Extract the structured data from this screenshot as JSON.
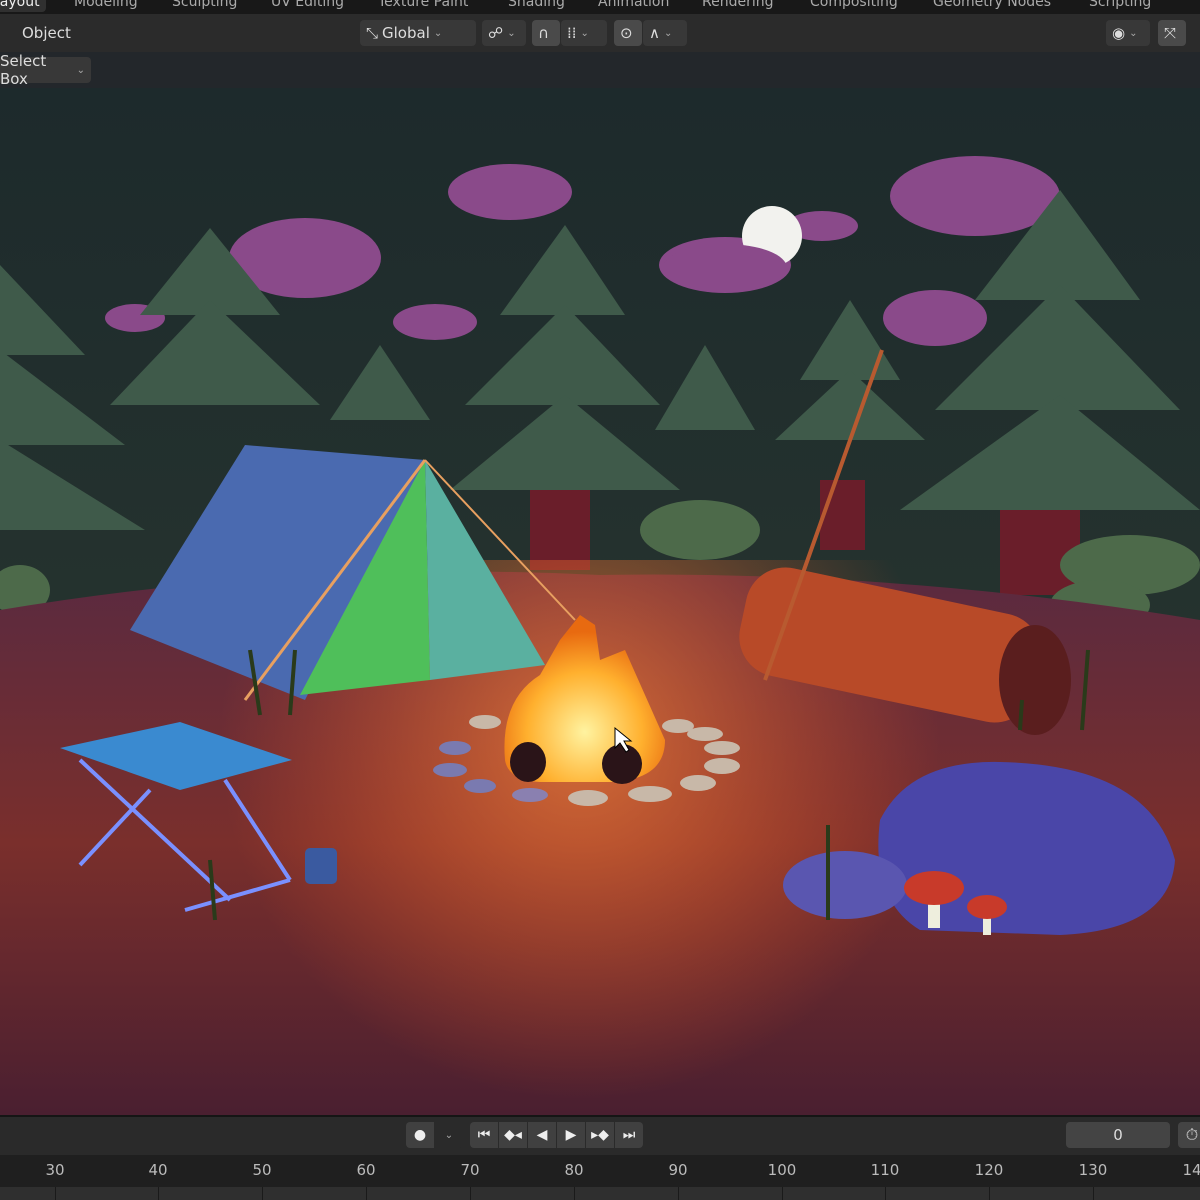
{
  "workspaces": [
    "Layout",
    "Modeling",
    "Sculpting",
    "UV Editing",
    "Texture Paint",
    "Shading",
    "Animation",
    "Rendering",
    "Compositing",
    "Geometry Nodes",
    "Scripting"
  ],
  "header": {
    "mode_menu": "Object",
    "transform_orientation": "Global"
  },
  "toolbar": {
    "select_mode": "Select Box"
  },
  "timeline": {
    "current_frame": "0",
    "ticks": [
      "30",
      "40",
      "50",
      "60",
      "70",
      "80",
      "90",
      "100",
      "110",
      "120",
      "130",
      "14"
    ]
  },
  "colors": {
    "header_bg": "#2b2b2b",
    "accent": "#4772b3",
    "fire": "#ffb02e"
  }
}
